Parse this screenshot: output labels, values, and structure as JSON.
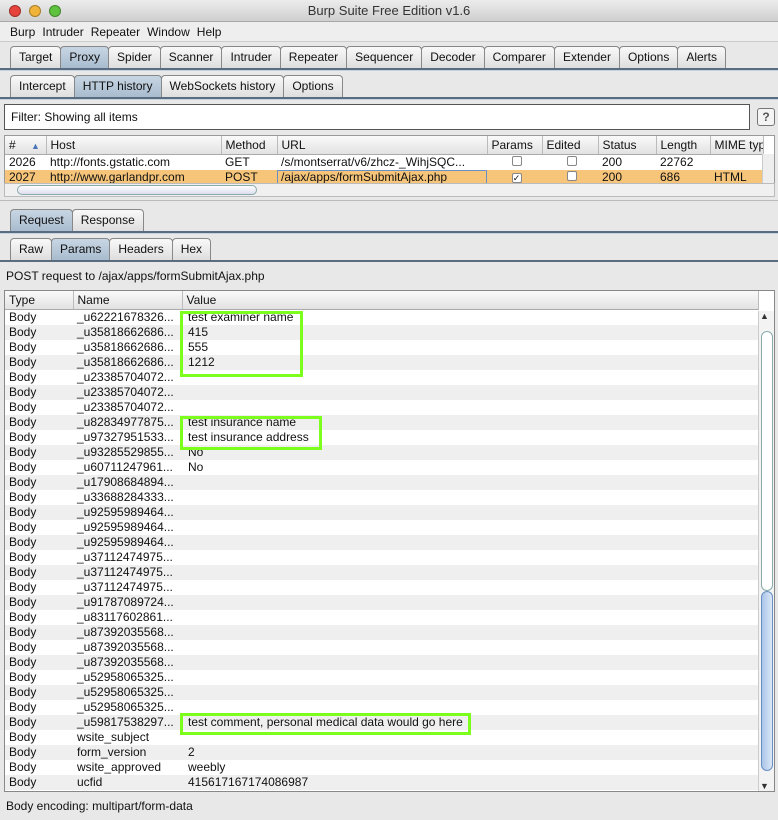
{
  "window": {
    "title": "Burp Suite Free Edition v1.6"
  },
  "menu": [
    "Burp",
    "Intruder",
    "Repeater",
    "Window",
    "Help"
  ],
  "main_tabs": [
    "Target",
    "Proxy",
    "Spider",
    "Scanner",
    "Intruder",
    "Repeater",
    "Sequencer",
    "Decoder",
    "Comparer",
    "Extender",
    "Options",
    "Alerts"
  ],
  "proxy_tabs": [
    "Intercept",
    "HTTP history",
    "WebSockets history",
    "Options"
  ],
  "filter": "Filter: Showing all items",
  "help_label": "?",
  "history": {
    "columns": [
      "#",
      "Host",
      "Method",
      "URL",
      "Params",
      "Edited",
      "Status",
      "Length",
      "MIME typ"
    ],
    "rows": [
      {
        "num": "2026",
        "host": "http://fonts.gstatic.com",
        "method": "GET",
        "url": "/s/montserrat/v6/zhcz-_WihjSQC...",
        "params": false,
        "edited": false,
        "status": "200",
        "length": "22762",
        "mime": ""
      },
      {
        "num": "2027",
        "host": "http://www.garlandpr.com",
        "method": "POST",
        "url": "/ajax/apps/formSubmitAjax.php",
        "params": true,
        "edited": false,
        "status": "200",
        "length": "686",
        "mime": "HTML"
      }
    ]
  },
  "msg_tabs": [
    "Request",
    "Response"
  ],
  "view_tabs": [
    "Raw",
    "Params",
    "Headers",
    "Hex"
  ],
  "request_summary": "POST request to /ajax/apps/formSubmitAjax.php",
  "params": {
    "columns": [
      "Type",
      "Name",
      "Value"
    ],
    "rows": [
      [
        "Body",
        "_u62221678326...",
        "test examiner name"
      ],
      [
        "Body",
        "_u35818662686...",
        "415"
      ],
      [
        "Body",
        "_u35818662686...",
        "555"
      ],
      [
        "Body",
        "_u35818662686...",
        "1212"
      ],
      [
        "Body",
        "_u23385704072...",
        ""
      ],
      [
        "Body",
        "_u23385704072...",
        ""
      ],
      [
        "Body",
        "_u23385704072...",
        ""
      ],
      [
        "Body",
        "_u82834977875...",
        "test insurance name"
      ],
      [
        "Body",
        "_u97327951533...",
        "test insurance address"
      ],
      [
        "Body",
        "_u93285529855...",
        "No"
      ],
      [
        "Body",
        "_u60711247961...",
        "No"
      ],
      [
        "Body",
        "_u17908684894...",
        ""
      ],
      [
        "Body",
        "_u33688284333...",
        ""
      ],
      [
        "Body",
        "_u92595989464...",
        ""
      ],
      [
        "Body",
        "_u92595989464...",
        ""
      ],
      [
        "Body",
        "_u92595989464...",
        ""
      ],
      [
        "Body",
        "_u37112474975...",
        ""
      ],
      [
        "Body",
        "_u37112474975...",
        ""
      ],
      [
        "Body",
        "_u37112474975...",
        ""
      ],
      [
        "Body",
        "_u91787089724...",
        ""
      ],
      [
        "Body",
        "_u83117602861...",
        ""
      ],
      [
        "Body",
        "_u87392035568...",
        ""
      ],
      [
        "Body",
        "_u87392035568...",
        ""
      ],
      [
        "Body",
        "_u87392035568...",
        ""
      ],
      [
        "Body",
        "_u52958065325...",
        ""
      ],
      [
        "Body",
        "_u52958065325...",
        ""
      ],
      [
        "Body",
        "_u52958065325...",
        ""
      ],
      [
        "Body",
        "_u59817538297...",
        "test comment, personal medical data would go here"
      ],
      [
        "Body",
        "wsite_subject",
        ""
      ],
      [
        "Body",
        "form_version",
        "2"
      ],
      [
        "Body",
        "wsite_approved",
        "weebly"
      ],
      [
        "Body",
        "ucfid",
        "415617167174086987"
      ]
    ]
  },
  "status_bar": "Body encoding: multipart/form-data",
  "colors": {
    "selected_row": "#f6c57a",
    "highlight": "#7dff1e",
    "tab_selected": "#a8bccf"
  }
}
